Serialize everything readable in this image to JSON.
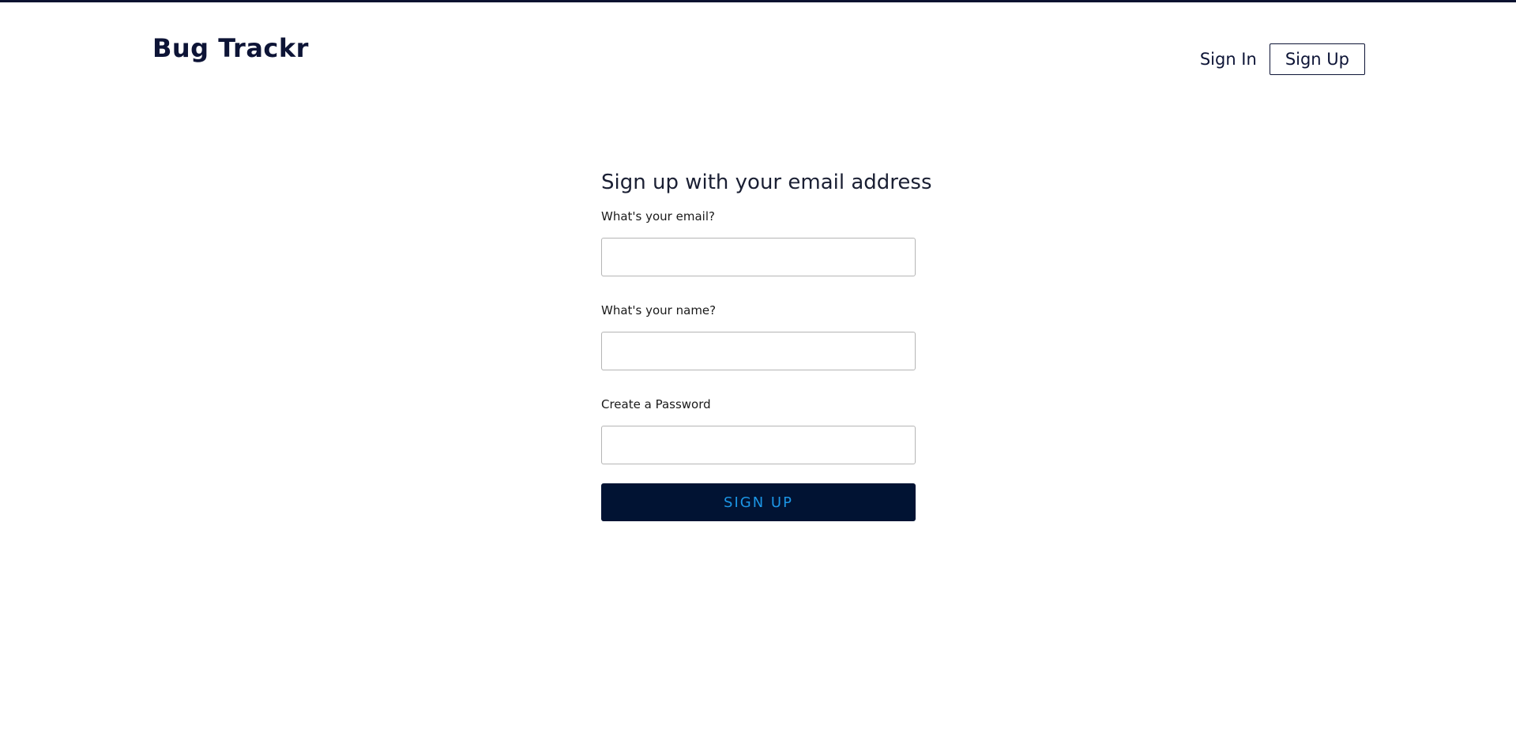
{
  "header": {
    "logo_text": "Bug Trackr",
    "nav": {
      "sign_in_label": "Sign In",
      "sign_up_label": "Sign Up"
    }
  },
  "form": {
    "title": "Sign up with your email address",
    "fields": [
      {
        "label": "What's your email?",
        "value": "",
        "placeholder": ""
      },
      {
        "label": "What's your name?",
        "value": "",
        "placeholder": ""
      },
      {
        "label": "Create a Password",
        "value": "",
        "placeholder": ""
      }
    ],
    "submit_label": "SIGN UP"
  },
  "colors": {
    "brand_navy": "#0d1436",
    "button_bg": "#011333",
    "button_text": "#1c96e6",
    "input_border": "#b5b5b5"
  }
}
